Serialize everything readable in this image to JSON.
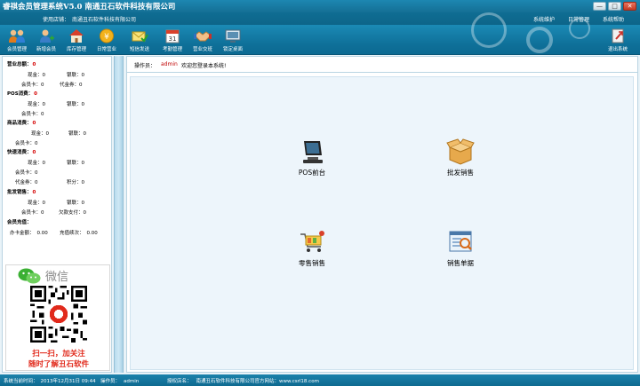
{
  "app": {
    "title": "睿祺会员管理系统V5.0  南通丑石软件科技有限公司",
    "window_buttons": [
      "—",
      "□",
      "✕"
    ]
  },
  "store": {
    "label": "使用店铺：",
    "name": "南通丑石软件科技有限公司"
  },
  "top_menu": [
    "系统维护",
    "日常管理",
    "系统帮助"
  ],
  "toolbar": [
    {
      "label": "会员管理",
      "icon": "members-icon"
    },
    {
      "label": "新增会员",
      "icon": "add-member-icon"
    },
    {
      "label": "库存管理",
      "icon": "home-icon"
    },
    {
      "label": "日常营业",
      "icon": "coin-icon"
    },
    {
      "label": "短信发送",
      "icon": "sms-icon"
    },
    {
      "label": "考勤管理",
      "icon": "calendar-icon"
    },
    {
      "label": "营业交班",
      "icon": "handshake-icon"
    },
    {
      "label": "锁定桌面",
      "icon": "lock-screen-icon"
    },
    {
      "label": "退出系统",
      "icon": "exit-icon"
    }
  ],
  "stats": {
    "revenue": {
      "title": "营业总额：",
      "value": "0",
      "cash_label": "现金：",
      "cash": "0",
      "swipe_label": "银联：",
      "swipe": "0",
      "card_label": "会员卡：",
      "card": "0",
      "coupon_label": "代金券：",
      "coupon": "0"
    },
    "pos": {
      "title": "POS消费：",
      "value": "0",
      "cash_label": "现金：",
      "cash": "0",
      "swipe_label": "银联：",
      "swipe": "0",
      "card_label": "会员卡：",
      "card": "0"
    },
    "goods": {
      "title": "商品消费：",
      "value": "0",
      "cash_label": "现金：",
      "cash": "0",
      "swipe_label": "银联：",
      "swipe": "0",
      "card_label": "会员卡：",
      "card": "0"
    },
    "fast": {
      "title": "快速消费：",
      "value": "0",
      "cash_label": "现金：",
      "cash": "0",
      "swipe_label": "银联：",
      "swipe": "0",
      "card_label": "会员卡：",
      "card": "0",
      "coupon_label": "代金券：",
      "coupon": "0",
      "points_label": "积分：",
      "points": "0"
    },
    "wholesale": {
      "title": "批发销售：",
      "value": "0",
      "cash_label": "现金：",
      "cash": "0",
      "swipe_label": "银联：",
      "swipe": "0",
      "card_label": "会员卡：",
      "card": "0",
      "owed_label": "欠款支付：",
      "owed": "0"
    },
    "recharge": {
      "title": "会员充值：",
      "amount_label": "办卡金额：",
      "amount": "0.00",
      "times_label": "充值续次：",
      "times": "0.00"
    }
  },
  "wechat": {
    "title": "微信",
    "line1": "扫一扫，加关注",
    "line2": "随时了解丑石软件"
  },
  "operator_bar": {
    "label": "操作员：",
    "name": "admin",
    "message": "欢迎您登录本系统!"
  },
  "functions": [
    {
      "label": "POS前台",
      "icon": "pos-terminal-icon"
    },
    {
      "label": "批发销售",
      "icon": "box-icon"
    },
    {
      "label": "零售销售",
      "icon": "cart-icon"
    },
    {
      "label": "销售单据",
      "icon": "report-icon"
    }
  ],
  "status": {
    "time_label": "系统当前时间：",
    "time": "2013年12月31日 09:44",
    "operator_label": "操作员：",
    "operator": "admin",
    "license_label": "授权店名：",
    "license": "南通丑石软件科技有限公司官方网站：www.csrl18.com"
  },
  "colors": {
    "accent": "#146f95",
    "status_red": "#d40000"
  }
}
